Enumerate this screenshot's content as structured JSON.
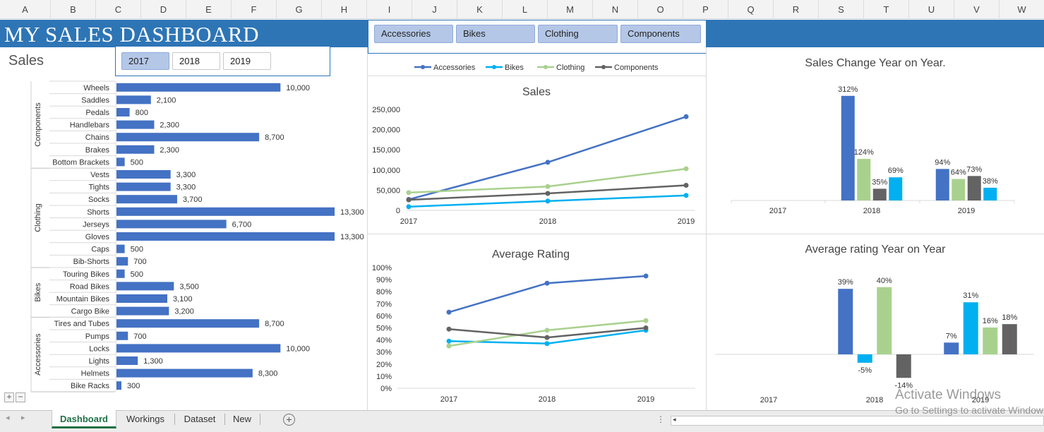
{
  "columns": [
    "A",
    "B",
    "C",
    "D",
    "E",
    "F",
    "G",
    "H",
    "I",
    "J",
    "K",
    "L",
    "M",
    "N",
    "O",
    "P",
    "Q",
    "R",
    "S",
    "T",
    "U",
    "V",
    "W"
  ],
  "dashboard": {
    "title": "MY SALES DASHBOARD",
    "sales_label": "Sales",
    "category_slicer": [
      "Accessories",
      "Bikes",
      "Clothing",
      "Components"
    ],
    "year_slicer": {
      "options": [
        "2017",
        "2018",
        "2019"
      ],
      "selected": "2017"
    }
  },
  "colors": {
    "header_band": "#2e75b6",
    "accessories": "#4472c4",
    "bikes": "#00b0f0",
    "clothing": "#a9d18e",
    "components": "#636363",
    "bar": "#4472c4"
  },
  "chart_data": [
    {
      "id": "product_sales",
      "type": "bar",
      "orientation": "horizontal",
      "groups": [
        {
          "name": "Components",
          "items": [
            {
              "label": "Wheels",
              "value": 10000,
              "display": "10,000"
            },
            {
              "label": "Saddles",
              "value": 2100,
              "display": "2,100"
            },
            {
              "label": "Pedals",
              "value": 800,
              "display": "800"
            },
            {
              "label": "Handlebars",
              "value": 2300,
              "display": "2,300"
            },
            {
              "label": "Chains",
              "value": 8700,
              "display": "8,700"
            },
            {
              "label": "Brakes",
              "value": 2300,
              "display": "2,300"
            },
            {
              "label": "Bottom Brackets",
              "value": 500,
              "display": "500"
            }
          ]
        },
        {
          "name": "Clothing",
          "items": [
            {
              "label": "Vests",
              "value": 3300,
              "display": "3,300"
            },
            {
              "label": "Tights",
              "value": 3300,
              "display": "3,300"
            },
            {
              "label": "Socks",
              "value": 3700,
              "display": "3,700"
            },
            {
              "label": "Shorts",
              "value": 13300,
              "display": "13,300"
            },
            {
              "label": "Jerseys",
              "value": 6700,
              "display": "6,700"
            },
            {
              "label": "Gloves",
              "value": 13300,
              "display": "13,300"
            },
            {
              "label": "Caps",
              "value": 500,
              "display": "500"
            },
            {
              "label": "Bib-Shorts",
              "value": 700,
              "display": "700"
            }
          ]
        },
        {
          "name": "Bikes",
          "items": [
            {
              "label": "Touring Bikes",
              "value": 500,
              "display": "500"
            },
            {
              "label": "Road Bikes",
              "value": 3500,
              "display": "3,500"
            },
            {
              "label": "Mountain Bikes",
              "value": 3100,
              "display": "3,100"
            },
            {
              "label": "Cargo Bike",
              "value": 3200,
              "display": "3,200"
            }
          ]
        },
        {
          "name": "Accessories",
          "items": [
            {
              "label": "Tires and Tubes",
              "value": 8700,
              "display": "8,700"
            },
            {
              "label": "Pumps",
              "value": 700,
              "display": "700"
            },
            {
              "label": "Locks",
              "value": 10000,
              "display": "10,000"
            },
            {
              "label": "Lights",
              "value": 1300,
              "display": "1,300"
            },
            {
              "label": "Helmets",
              "value": 8300,
              "display": "8,300"
            },
            {
              "label": "Bike Racks",
              "value": 300,
              "display": "300"
            }
          ]
        }
      ]
    },
    {
      "id": "sales_line",
      "type": "line",
      "title": "Sales",
      "x": [
        "2017",
        "2018",
        "2019"
      ],
      "ylim": [
        0,
        250000
      ],
      "yticks": [
        0,
        50000,
        100000,
        150000,
        200000,
        250000
      ],
      "ytick_labels": [
        "0",
        "50,000",
        "100,000",
        "150,000",
        "200,000",
        "250,000"
      ],
      "legend": "top",
      "series": [
        {
          "name": "Accessories",
          "values": [
            27000,
            119000,
            232000
          ]
        },
        {
          "name": "Bikes",
          "values": [
            9000,
            23000,
            37000
          ]
        },
        {
          "name": "Clothing",
          "values": [
            44000,
            59000,
            103000
          ]
        },
        {
          "name": "Components",
          "values": [
            26000,
            42000,
            62000
          ]
        }
      ]
    },
    {
      "id": "sales_change",
      "type": "bar",
      "title": "Sales Change Year on Year.",
      "categories": [
        "2017",
        "2018",
        "2019"
      ],
      "series": [
        {
          "name": "Accessories",
          "values": [
            null,
            312,
            94
          ],
          "labels": [
            "",
            "312%",
            "94%"
          ]
        },
        {
          "name": "Clothing",
          "values": [
            null,
            124,
            64
          ],
          "labels": [
            "",
            "124%",
            "64%"
          ]
        },
        {
          "name": "Components",
          "values": [
            null,
            35,
            73
          ],
          "labels": [
            "",
            "35%",
            "73%"
          ]
        },
        {
          "name": "Bikes",
          "values": [
            null,
            69,
            38
          ],
          "labels": [
            "",
            "69%",
            "38%"
          ]
        }
      ]
    },
    {
      "id": "avg_rating_line",
      "type": "line",
      "title": "Average Rating",
      "x": [
        "2017",
        "2018",
        "2019"
      ],
      "ylim": [
        0,
        100
      ],
      "yticks": [
        0,
        10,
        20,
        30,
        40,
        50,
        60,
        70,
        80,
        90,
        100
      ],
      "ytick_labels": [
        "0%",
        "10%",
        "20%",
        "30%",
        "40%",
        "50%",
        "60%",
        "70%",
        "80%",
        "90%",
        "100%"
      ],
      "series": [
        {
          "name": "Accessories",
          "values": [
            63,
            87,
            93
          ]
        },
        {
          "name": "Bikes",
          "values": [
            39,
            37,
            48
          ]
        },
        {
          "name": "Clothing",
          "values": [
            35,
            48,
            56
          ]
        },
        {
          "name": "Components",
          "values": [
            49,
            42,
            50
          ]
        }
      ]
    },
    {
      "id": "avg_rating_change",
      "type": "bar",
      "title": "Average rating Year on Year",
      "categories": [
        "2017",
        "2018",
        "2019"
      ],
      "series": [
        {
          "name": "Accessories",
          "values": [
            null,
            39,
            7
          ],
          "labels": [
            "",
            "39%",
            "7%"
          ]
        },
        {
          "name": "Bikes",
          "values": [
            null,
            -5,
            31
          ],
          "labels": [
            "",
            "-5%",
            "31%"
          ]
        },
        {
          "name": "Clothing",
          "values": [
            null,
            40,
            16
          ],
          "labels": [
            "",
            "40%",
            "16%"
          ]
        },
        {
          "name": "Components",
          "values": [
            null,
            -14,
            18
          ],
          "labels": [
            "",
            "-14%",
            "18%"
          ]
        }
      ]
    }
  ],
  "sheet_tabs": [
    "Dashboard",
    "Workings",
    "Dataset",
    "New"
  ],
  "active_tab": "Dashboard",
  "outline_buttons": [
    "+",
    "−"
  ],
  "add_sheet_symbol": "+",
  "scroll_menu": "⋮",
  "scroll_left": "◂",
  "tab_nav": [
    "◂",
    "▸"
  ],
  "watermark": {
    "line1": "Activate Windows",
    "line2": "Go to Settings to activate Windows."
  }
}
